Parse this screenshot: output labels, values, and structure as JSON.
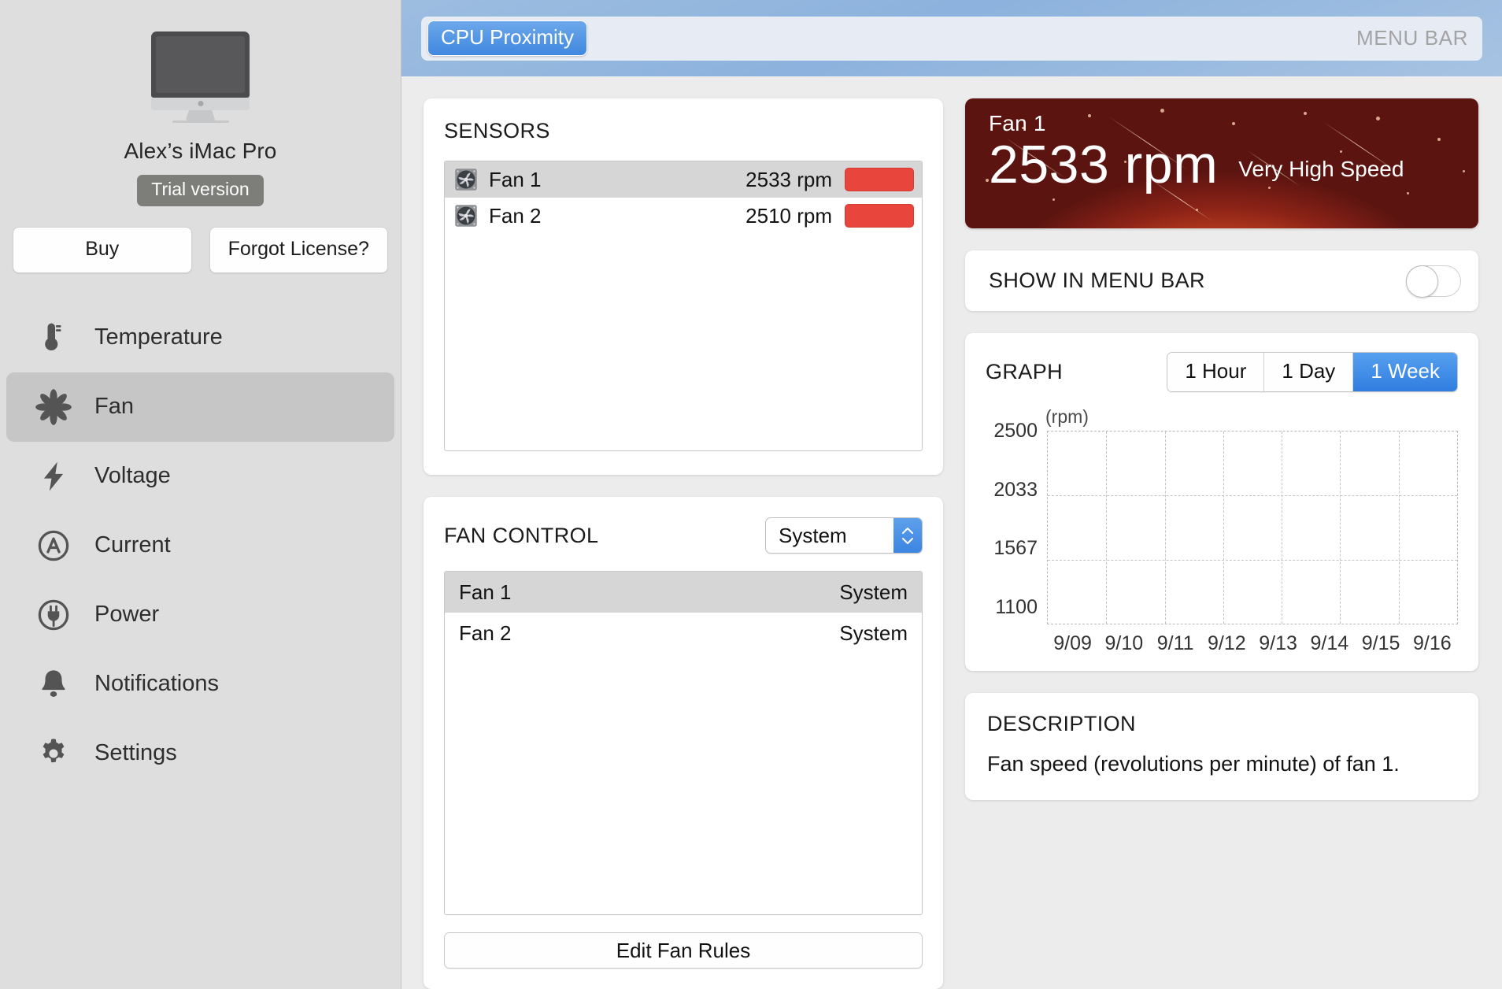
{
  "sidebar": {
    "device_name": "Alex’s iMac Pro",
    "trial_badge": "Trial version",
    "buy_label": "Buy",
    "forgot_license_label": "Forgot License?",
    "items": [
      {
        "label": "Temperature",
        "icon": "thermometer-icon",
        "active": false
      },
      {
        "label": "Fan",
        "icon": "fan-icon",
        "active": true
      },
      {
        "label": "Voltage",
        "icon": "bolt-icon",
        "active": false
      },
      {
        "label": "Current",
        "icon": "ampere-circle-icon",
        "active": false
      },
      {
        "label": "Power",
        "icon": "power-plug-icon",
        "active": false
      },
      {
        "label": "Notifications",
        "icon": "bell-icon",
        "active": false
      },
      {
        "label": "Settings",
        "icon": "gear-icon",
        "active": false
      }
    ]
  },
  "menubar": {
    "chip_label": "CPU Proximity",
    "right_label": "MENU BAR"
  },
  "sensors": {
    "title": "SENSORS",
    "rows": [
      {
        "name": "Fan 1",
        "value": "2533 rpm",
        "selected": true
      },
      {
        "name": "Fan 2",
        "value": "2510 rpm",
        "selected": false
      }
    ]
  },
  "fan_control": {
    "title": "FAN CONTROL",
    "mode_value": "System",
    "rows": [
      {
        "name": "Fan 1",
        "mode": "System",
        "selected": true
      },
      {
        "name": "Fan 2",
        "mode": "System",
        "selected": false
      }
    ],
    "edit_button": "Edit Fan Rules"
  },
  "hero": {
    "title": "Fan 1",
    "value": "2533 rpm",
    "status": "Very High Speed",
    "accent_color": "#b0341c"
  },
  "menu_toggle": {
    "label": "SHOW IN MENU BAR",
    "state": "off"
  },
  "graph": {
    "title": "GRAPH",
    "ranges": [
      {
        "label": "1 Hour",
        "active": false
      },
      {
        "label": "1 Day",
        "active": false
      },
      {
        "label": "1 Week",
        "active": true
      }
    ]
  },
  "description": {
    "title": "DESCRIPTION",
    "text": "Fan speed (revolutions per minute) of fan 1."
  },
  "chart_data": {
    "type": "line",
    "title": "GRAPH",
    "unit_label": "(rpm)",
    "ylabel": "(rpm)",
    "xlabel": "",
    "yticks": [
      2500,
      2033,
      1567,
      1100
    ],
    "ylim": [
      1100,
      2500
    ],
    "categories": [
      "9/09",
      "9/10",
      "9/11",
      "9/12",
      "9/13",
      "9/14",
      "9/15",
      "9/16"
    ],
    "series": [
      {
        "name": "Fan 1",
        "values": []
      }
    ],
    "grid": true,
    "legend": "none",
    "note": "Empty plot area — no data plotted for the 1 Week range"
  }
}
